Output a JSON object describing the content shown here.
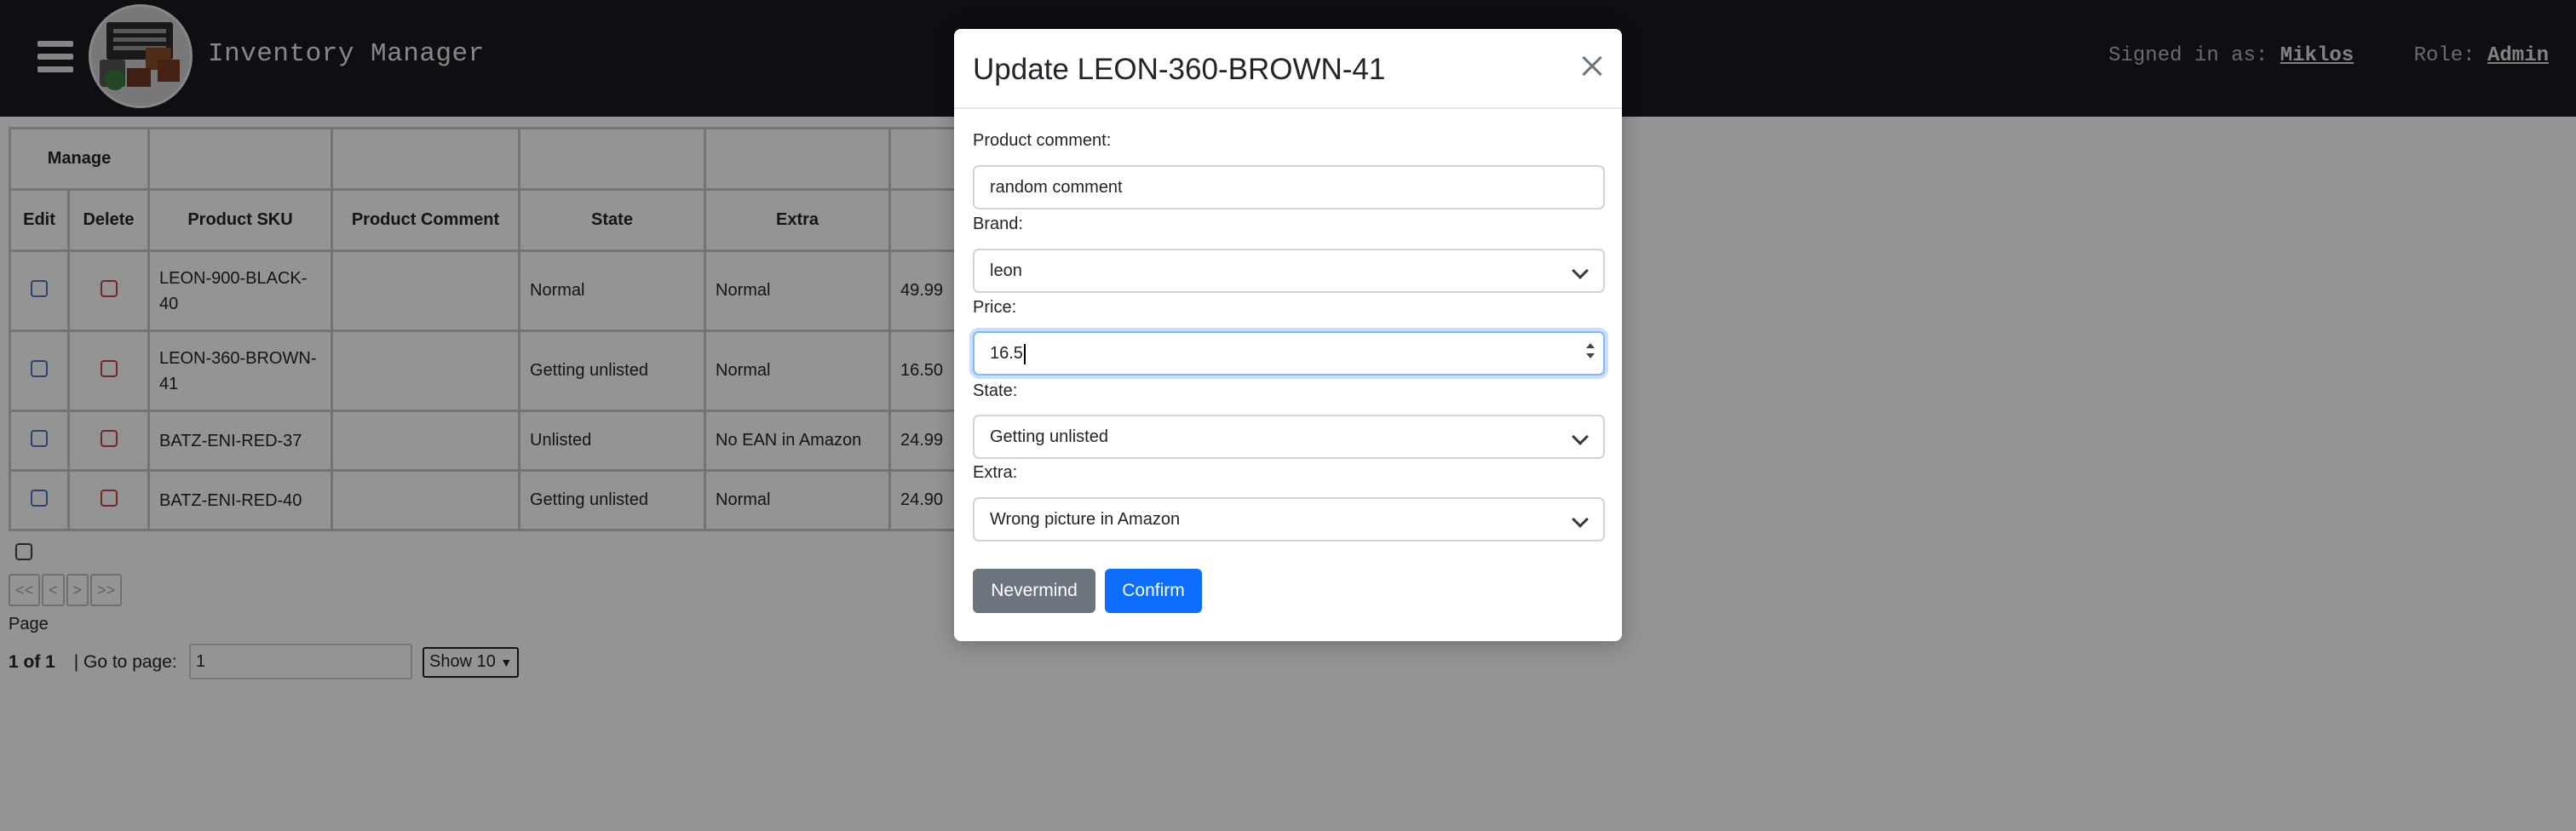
{
  "header": {
    "app_title": "Inventory Manager",
    "signed_in_label": "Signed in as:",
    "user_name": "Miklos",
    "role_label": "Role:",
    "role_name": "Admin"
  },
  "table": {
    "group_header": "Manage",
    "columns": [
      "Edit",
      "Delete",
      "Product SKU",
      "Product Comment",
      "State",
      "Extra"
    ],
    "rows": [
      {
        "sku": "LEON-900-BLACK-40",
        "comment": "",
        "state": "Normal",
        "extra": "Normal",
        "price": "49.99"
      },
      {
        "sku": "LEON-360-BROWN-41",
        "comment": "",
        "state": "Getting unlisted",
        "extra": "Normal",
        "price": "16.50"
      },
      {
        "sku": "BATZ-ENI-RED-37",
        "comment": "",
        "state": "Unlisted",
        "extra": "No EAN in Amazon",
        "price": "24.99"
      },
      {
        "sku": "BATZ-ENI-RED-40",
        "comment": "",
        "state": "Getting unlisted",
        "extra": "Normal",
        "price": "24.90"
      }
    ]
  },
  "pagination": {
    "first": "<<",
    "prev": "<",
    "next": ">",
    "last": ">>",
    "page_label": "Page",
    "page_of": "1 of 1",
    "goto_label": "| Go to page:",
    "goto_value": "1",
    "show_value": "Show 10"
  },
  "modal": {
    "title": "Update LEON-360-BROWN-41",
    "comment_label": "Product comment:",
    "comment_value": "random comment",
    "brand_label": "Brand:",
    "brand_value": "leon",
    "price_label": "Price:",
    "price_value": "16.5",
    "state_label": "State:",
    "state_value": "Getting unlisted",
    "extra_label": "Extra:",
    "extra_value": "Wrong picture in Amazon",
    "cancel_label": "Nevermind",
    "confirm_label": "Confirm"
  },
  "colors": {
    "navbar": "#191b21",
    "primary": "#0d6efd",
    "secondary": "#6c757d",
    "edit_checkbox": "#4a72c7",
    "delete_checkbox": "#c94444"
  }
}
